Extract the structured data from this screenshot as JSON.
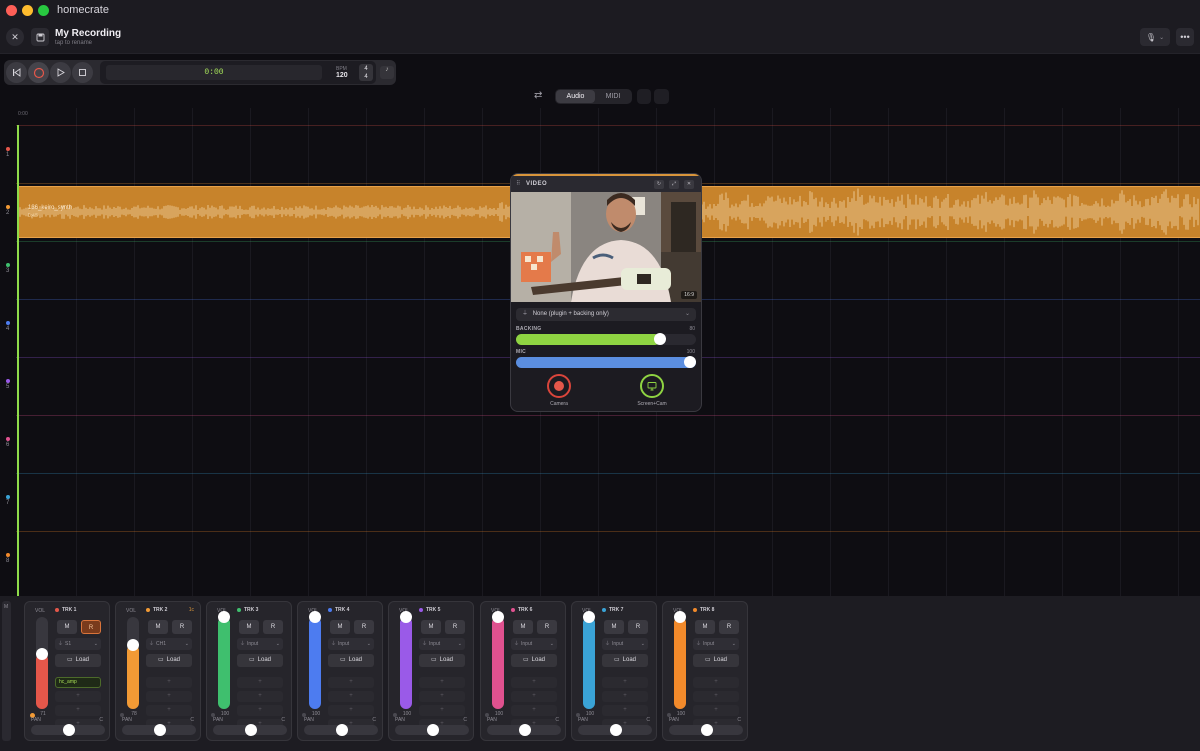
{
  "app": {
    "title": "homecrate"
  },
  "header": {
    "recording_title": "My Recording",
    "recording_hint": "tap to rename"
  },
  "transport": {
    "time": "0:00",
    "bpm_label": "BPM",
    "bpm": "120",
    "time_sig_top": "4",
    "time_sig_bottom": "4"
  },
  "mode": {
    "audio_label": "Audio",
    "midi_label": "MIDI",
    "selected": "Audio"
  },
  "timeline": {
    "ruler_start": "0:00",
    "lanes": [
      {
        "num": "1",
        "color": "#e4574a"
      },
      {
        "num": "2",
        "color": "#f29a35"
      },
      {
        "num": "3",
        "color": "#3fbf6e"
      },
      {
        "num": "4",
        "color": "#4d7cf0"
      },
      {
        "num": "5",
        "color": "#9a5ae8"
      },
      {
        "num": "6",
        "color": "#e0518f"
      },
      {
        "num": "7",
        "color": "#3aa3d6"
      },
      {
        "num": "8",
        "color": "#f28a2b"
      }
    ],
    "clip": {
      "name": "136_keiro_synth",
      "detail": "0:45"
    }
  },
  "video_panel": {
    "title": "VIDEO",
    "duration": "16:9",
    "source_select": "None (plugin + backing only)",
    "backing_label": "BACKING",
    "backing_value": "80",
    "backing_level": 0.8,
    "mic_label": "MIC",
    "mic_value": "100",
    "mic_level": 1.0,
    "camera_label": "Camera",
    "screencam_label": "Screen+Cam"
  },
  "mixer": {
    "side_label": "M",
    "vol_label": "VOL",
    "pan_label": "PAN",
    "pan_center": "C",
    "load_label": "Load",
    "tracks": [
      {
        "name": "TRK 1",
        "color": "#e4574a",
        "vol": "71",
        "level": 0.6,
        "input": "S1",
        "plugin": "hc_amp",
        "rec_armed": true,
        "extra": ""
      },
      {
        "name": "TRK 2",
        "color": "#f29a35",
        "vol": "78",
        "level": 0.7,
        "input": "CH1",
        "plugin": "",
        "rec_armed": false,
        "extra": "1c"
      },
      {
        "name": "TRK 3",
        "color": "#3fbf6e",
        "vol": "100",
        "level": 1.0,
        "input": "Input",
        "plugin": "",
        "rec_armed": false,
        "extra": ""
      },
      {
        "name": "TRK 4",
        "color": "#4d7cf0",
        "vol": "100",
        "level": 1.0,
        "input": "Input",
        "plugin": "",
        "rec_armed": false,
        "extra": ""
      },
      {
        "name": "TRK 5",
        "color": "#9a5ae8",
        "vol": "100",
        "level": 1.0,
        "input": "Input",
        "plugin": "",
        "rec_armed": false,
        "extra": ""
      },
      {
        "name": "TRK 6",
        "color": "#e0518f",
        "vol": "100",
        "level": 1.0,
        "input": "Input",
        "plugin": "",
        "rec_armed": false,
        "extra": ""
      },
      {
        "name": "TRK 7",
        "color": "#3aa3d6",
        "vol": "100",
        "level": 1.0,
        "input": "Input",
        "plugin": "",
        "rec_armed": false,
        "extra": ""
      },
      {
        "name": "TRK 8",
        "color": "#f28a2b",
        "vol": "100",
        "level": 1.0,
        "input": "Input",
        "plugin": "",
        "rec_armed": false,
        "extra": ""
      }
    ]
  }
}
